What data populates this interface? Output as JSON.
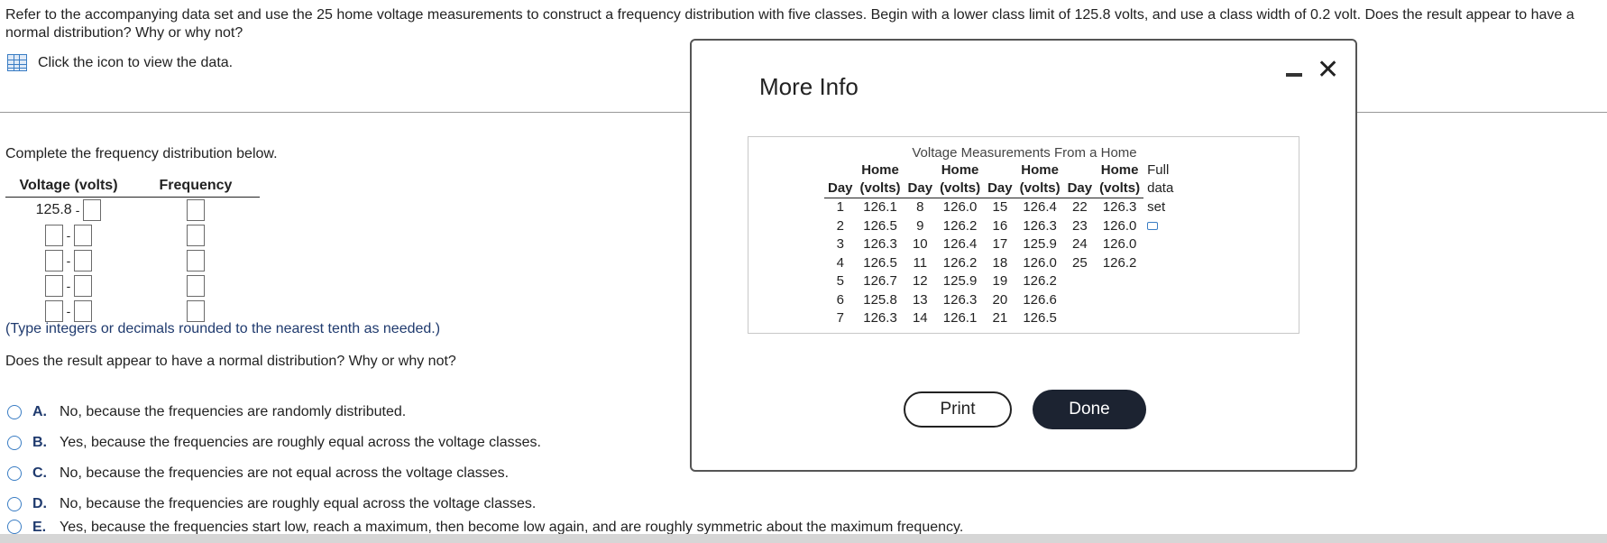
{
  "question": "Refer to the accompanying data set and use the 25 home voltage measurements to construct a frequency distribution with five classes. Begin with a lower class limit of 125.8 volts, and use a class width of 0.2 volt. Does the result appear to have a normal distribution? Why or why not?",
  "data_link": "Click the icon to view the data.",
  "complete_prompt": "Complete the frequency distribution below.",
  "freq_table": {
    "col_voltage": "Voltage (volts)",
    "col_frequency": "Frequency",
    "first_lower": "125.8",
    "dash": "-"
  },
  "hint": "(Type integers or decimals rounded to the nearest tenth as needed.)",
  "question2": "Does the result appear to have a normal distribution? Why or why not?",
  "options": [
    {
      "letter": "A.",
      "text": "No, because the frequencies are randomly distributed."
    },
    {
      "letter": "B.",
      "text": "Yes, because the frequencies are roughly equal across the voltage classes."
    },
    {
      "letter": "C.",
      "text": "No, because the frequencies are not equal across the voltage classes."
    },
    {
      "letter": "D.",
      "text": "No, because the frequencies are roughly equal across the voltage classes."
    },
    {
      "letter": "E.",
      "text": "Yes, because the frequencies start low, reach a maximum, then become low again, and are roughly symmetric about the maximum frequency."
    }
  ],
  "modal": {
    "title": "More Info",
    "data_title": "Voltage Measurements From a Home",
    "header_top": [
      "",
      "Home",
      "",
      "Home",
      "",
      "Home",
      "",
      "Home"
    ],
    "header_full": "Full",
    "header_bottom": [
      "Day",
      "(volts)",
      "Day",
      "(volts)",
      "Day",
      "(volts)",
      "Day",
      "(volts)"
    ],
    "header_data": "data",
    "rows": [
      [
        "1",
        "126.1",
        "8",
        "126.0",
        "15",
        "126.4",
        "22",
        "126.3"
      ],
      [
        "2",
        "126.5",
        "9",
        "126.2",
        "16",
        "126.3",
        "23",
        "126.0"
      ],
      [
        "3",
        "126.3",
        "10",
        "126.4",
        "17",
        "125.9",
        "24",
        "126.0"
      ],
      [
        "4",
        "126.5",
        "11",
        "126.2",
        "18",
        "126.0",
        "25",
        "126.2"
      ],
      [
        "5",
        "126.7",
        "12",
        "125.9",
        "19",
        "126.2",
        "",
        ""
      ],
      [
        "6",
        "125.8",
        "13",
        "126.3",
        "20",
        "126.6",
        "",
        ""
      ],
      [
        "7",
        "126.3",
        "14",
        "126.1",
        "21",
        "126.5",
        "",
        ""
      ]
    ],
    "set_label": "set",
    "print_label": "Print",
    "done_label": "Done"
  }
}
